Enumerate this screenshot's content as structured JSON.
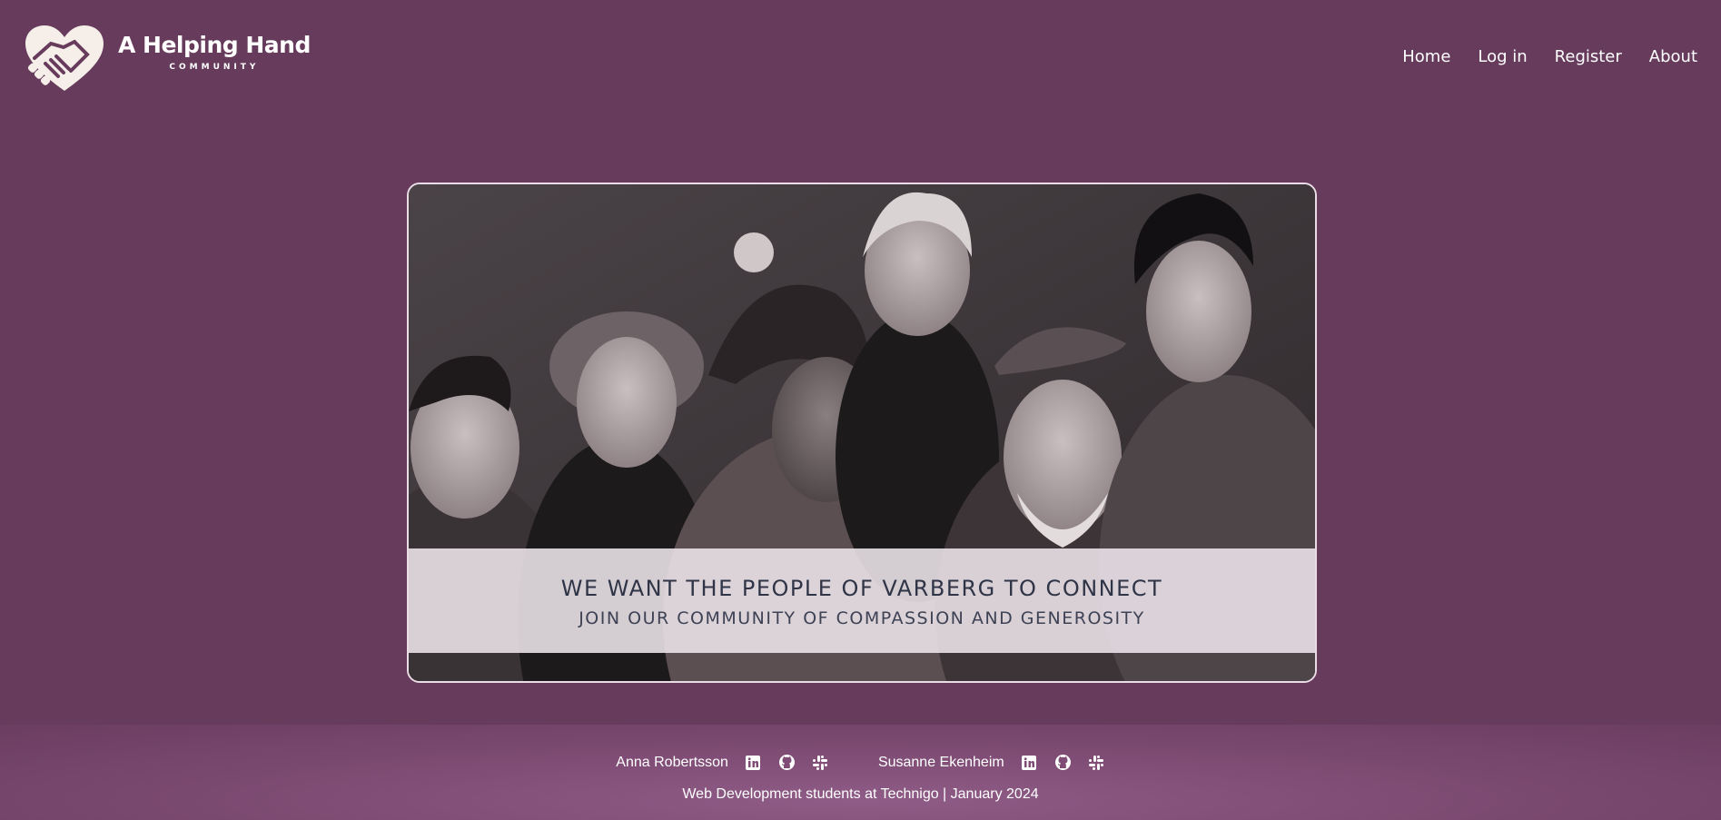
{
  "header": {
    "logo_title": "A Helping Hand",
    "logo_subtitle": "COMMUNITY",
    "nav": [
      "Home",
      "Log in",
      "Register",
      "About"
    ]
  },
  "hero": {
    "title": "WE WANT THE PEOPLE OF VARBERG TO CONNECT",
    "subtitle": "JOIN OUR COMMUNITY OF COMPASSION AND GENEROSITY"
  },
  "footer": {
    "people": [
      {
        "name": "Anna Robertsson",
        "icons": [
          "linkedin-icon",
          "github-icon",
          "slack-icon"
        ]
      },
      {
        "name": "Susanne Ekenheim",
        "icons": [
          "linkedin-icon",
          "github-icon",
          "slack-icon"
        ]
      }
    ],
    "note": "Web Development students at Technigo | January 2024"
  },
  "colors": {
    "background": "#673b5c",
    "footer": "#8a5880",
    "caption_text": "#2f3447"
  }
}
